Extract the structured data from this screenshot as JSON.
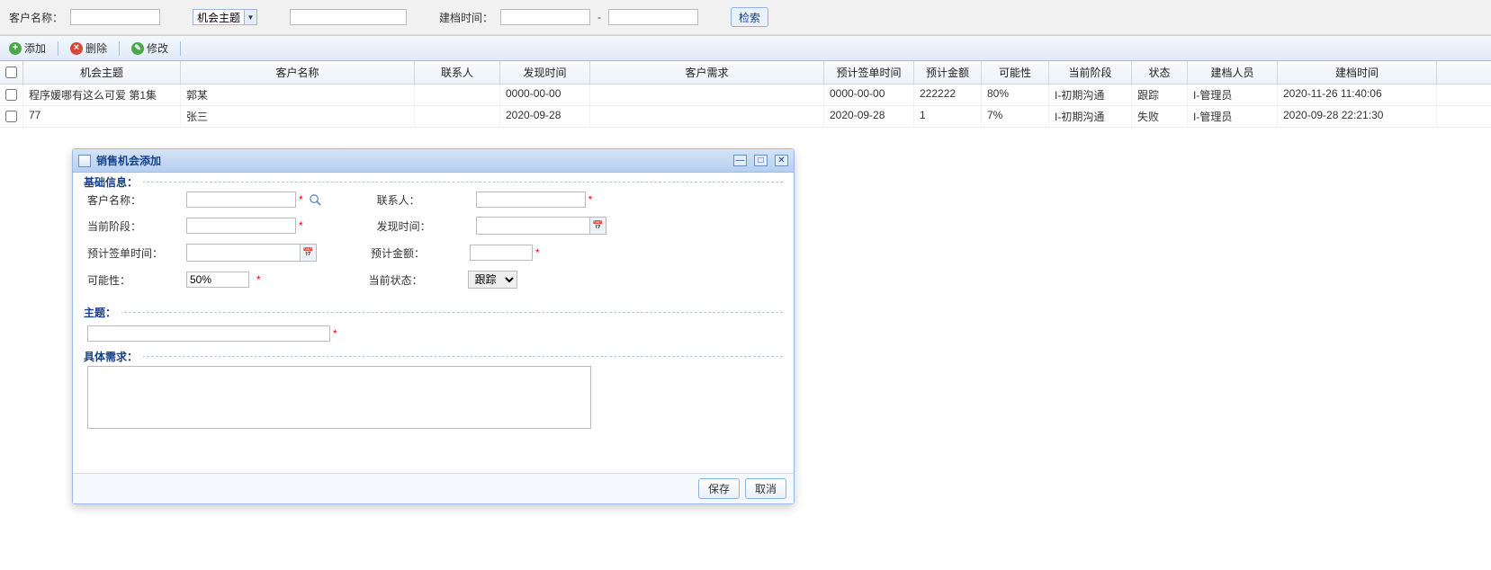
{
  "search": {
    "customer_label": "客户名称：",
    "topic_combo_label": "机会主题",
    "create_time_label": "建档时间：",
    "dash": "-",
    "submit": "检索"
  },
  "toolbar": {
    "add": "添加",
    "del": "删除",
    "edit": "修改"
  },
  "grid": {
    "headers": {
      "topic": "机会主题",
      "customer": "客户名称",
      "contact": "联系人",
      "find_time": "发现时间",
      "need": "客户需求",
      "est_time": "预计签单时间",
      "est_amt": "预计金额",
      "prob": "可能性",
      "stage": "当前阶段",
      "status": "状态",
      "clerk": "建档人员",
      "ctime": "建档时间"
    },
    "rows": [
      {
        "topic": "程序媛哪有这么可爱 第1集",
        "customer": "郭某",
        "contact": "",
        "find_time": "0000-00-00",
        "need": "",
        "est_time": "0000-00-00",
        "est_amt": "222222",
        "prob": "80%",
        "stage": "I-初期沟通",
        "status": "跟踪",
        "clerk": "I-管理员",
        "ctime": "2020-11-26 11:40:06"
      },
      {
        "topic": "77",
        "customer": "张三",
        "contact": "",
        "find_time": "2020-09-28",
        "need": "",
        "est_time": "2020-09-28",
        "est_amt": "1",
        "prob": "7%",
        "stage": "I-初期沟通",
        "status": "失败",
        "clerk": "I-管理员",
        "ctime": "2020-09-28 22:21:30"
      }
    ]
  },
  "dialog": {
    "title": "销售机会添加",
    "section_basic": "基础信息：",
    "fields": {
      "customer": "客户名称：",
      "contact": "联系人：",
      "stage": "当前阶段：",
      "find_time": "发现时间：",
      "est_time": "预计签单时间：",
      "est_amt": "预计金额：",
      "prob": "可能性：",
      "prob_value": "50%",
      "status": "当前状态：",
      "status_value": "跟踪"
    },
    "section_topic": "主题：",
    "section_need": "具体需求：",
    "buttons": {
      "save": "保存",
      "cancel": "取消"
    }
  }
}
